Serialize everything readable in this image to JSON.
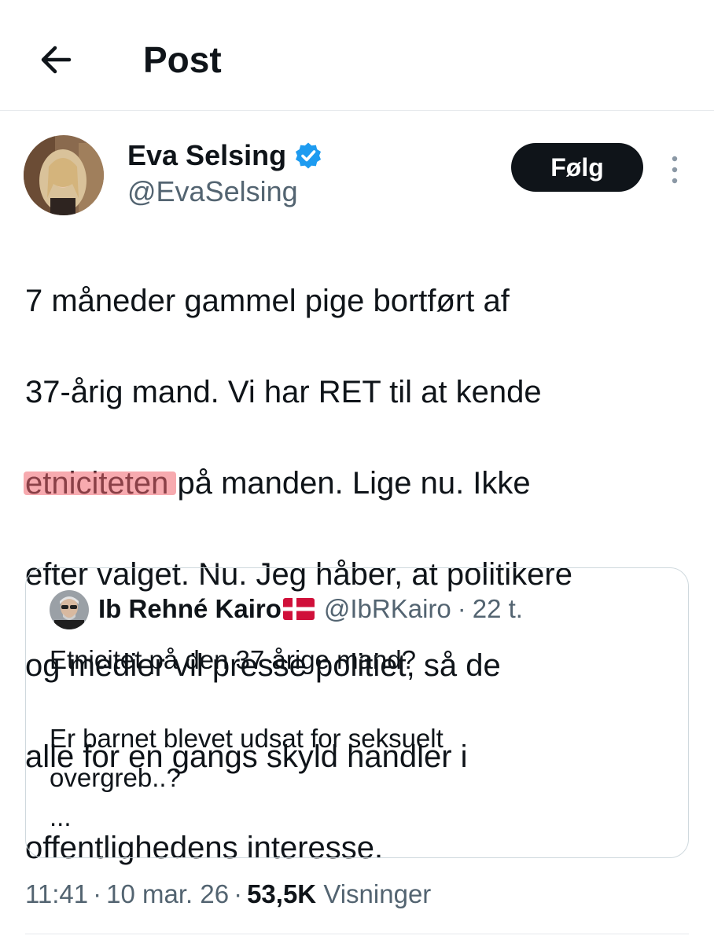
{
  "header": {
    "title": "Post",
    "back_icon": "arrow-left-icon"
  },
  "author": {
    "name": "Eva Selsing",
    "handle": "@EvaSelsing",
    "verified_icon": "verified-badge-icon",
    "verified_color": "#1d9bf0"
  },
  "actions": {
    "follow_label": "Følg",
    "more_icon": "more-vertical-icon"
  },
  "tweet": {
    "line1": "7 måneder gammel pige bortført af",
    "line2": "37-årig mand. Vi har RET til at kende",
    "line3_highlight": "etniciteten",
    "line3_rest": " på manden. Lige nu. Ikke",
    "line4": "efter valget. Nu. Jeg håber, at politikere",
    "line5": "og medier vil presse politiet, så de",
    "line6": "alle for en gangs skyld handler i",
    "line7": "offentlighedens interesse.",
    "highlight_color": "#f0646e"
  },
  "quote": {
    "name": "Ib Rehné Kairo",
    "flag_icon": "denmark-flag-icon",
    "handle": "@IbRKairo",
    "separator": "·",
    "time": "22 t.",
    "line1": "Etnicitet på den 37 årige mand?",
    "line2": "",
    "line3": "Er barnet blevet udsat for seksuelt",
    "line4": "overgreb..?",
    "line5": "..."
  },
  "meta": {
    "time": "11:41",
    "separator": "·",
    "date": "10 mar. 26",
    "views_count": "53,5K",
    "views_label": "Visninger"
  },
  "colors": {
    "text_primary": "#0f1419",
    "text_secondary": "#536471",
    "border": "#cfd9de",
    "button_bg": "#0f1419"
  }
}
